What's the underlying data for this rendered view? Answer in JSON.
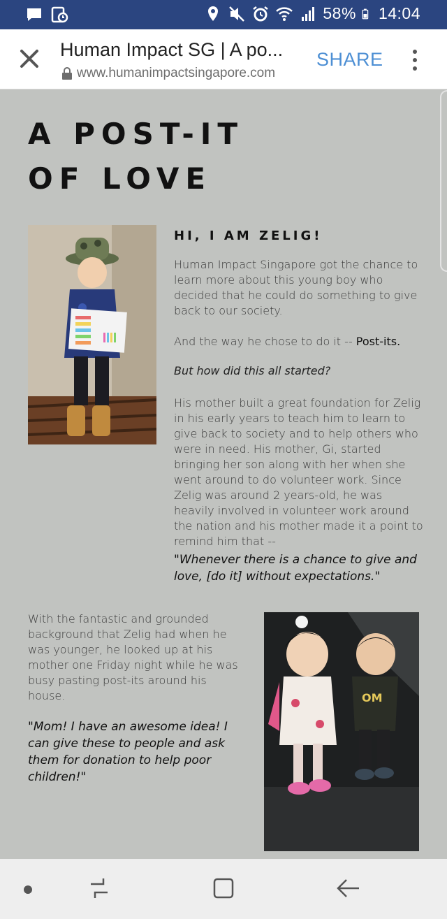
{
  "status_bar": {
    "battery": "58%",
    "time": "14:04",
    "icons": [
      "message-icon",
      "photo-notification-icon",
      "location-icon",
      "mute-icon",
      "alarm-icon",
      "wifi-icon",
      "signal-icon",
      "battery-icon"
    ]
  },
  "browser": {
    "title": "Human Impact SG | A po...",
    "url": "www.humanimpactsingapore.com",
    "share_label": "SHARE",
    "icons": [
      "close-icon",
      "lock-icon",
      "more-vert-icon"
    ]
  },
  "article": {
    "headline_line1": "A POST-IT",
    "headline_line2": "OF LOVE",
    "subhead": "HI, I AM ZELIG!",
    "p1": "Human Impact Singapore got the chance to learn more about this young boy who decided that he could do something to give back to our society.",
    "p2_prefix": "And the way he chose to do it -- ",
    "p2_bold": "Post-its.",
    "p3": "But how did this all started?",
    "p4": "His mother built a great foundation for Zelig in his early years to teach him to learn to give back to society and to help others who were in need. His mother, Gi, started bringing her son along with her when she went around to do volunteer work. Since Zelig was around 2 years-old, he was heavily involved in volunteer work around the nation and his mother made it a point to remind him that --",
    "quote1": "\"Whenever there is a chance to give and love, [do it] without expectations.\"",
    "p5": "With the fantastic and grounded background that Zelig had when he was younger, he looked up at his mother one Friday night while he was busy pasting post-its around his house.",
    "quote2": "\"Mom! I have an awesome idea! I can give these to people and ask them for donation to help poor children!\""
  },
  "nav_bar": {
    "icons": [
      "dot-icon",
      "recent-apps-icon",
      "home-icon",
      "back-icon"
    ]
  },
  "colors": {
    "status_bar": "#2b4580",
    "page_bg": "#c1c3c0",
    "share": "#4d8fd4"
  }
}
